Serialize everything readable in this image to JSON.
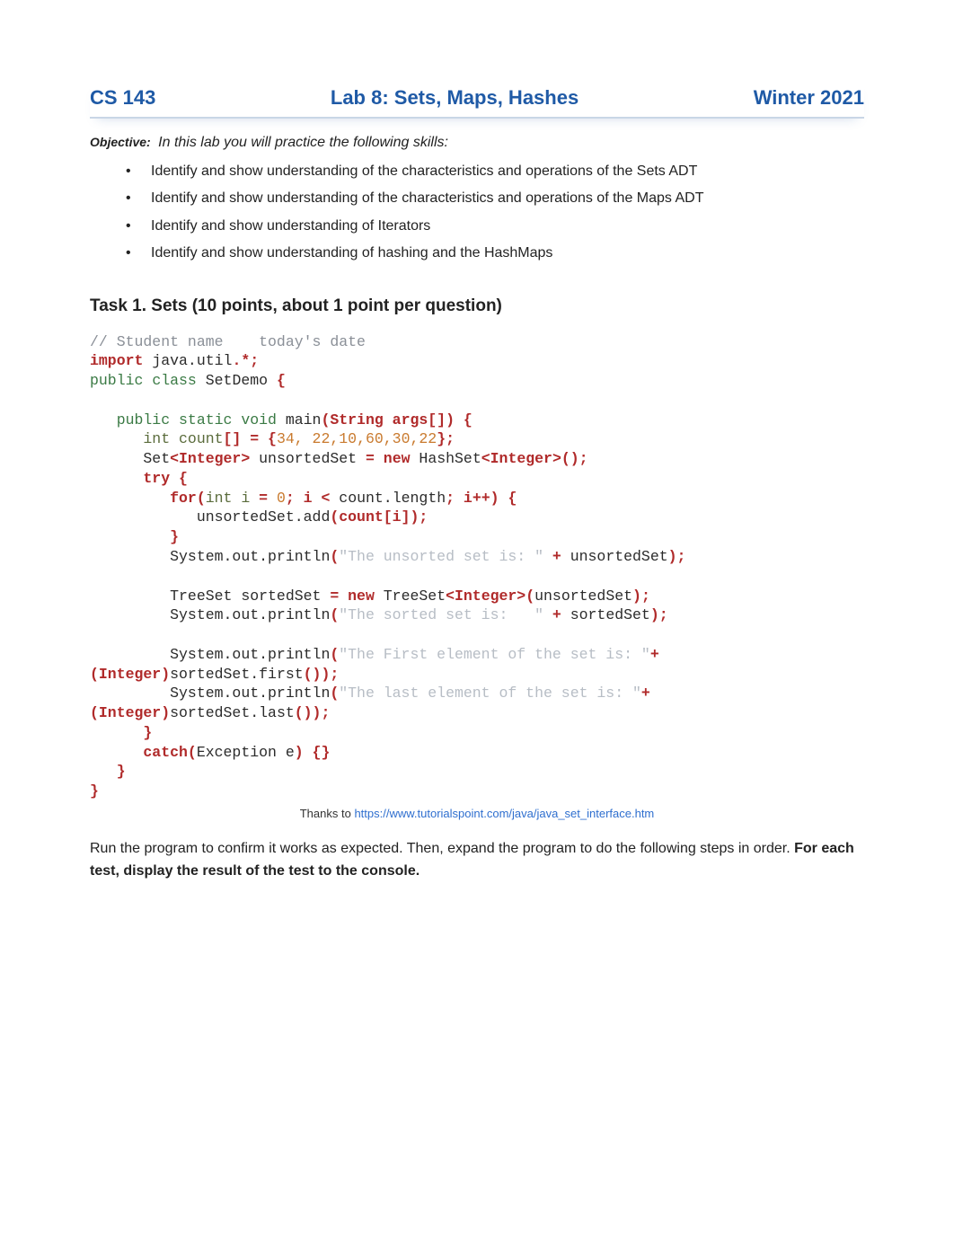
{
  "header": {
    "left": "CS 143",
    "center": "Lab 8:  Sets, Maps, Hashes",
    "right": "Winter 2021"
  },
  "objective": {
    "label": "Objective:",
    "text": "In this lab you will practice the following skills:",
    "bullets": [
      "Identify and show understanding of the characteristics and operations of the Sets ADT",
      "Identify and show understanding of the characteristics and operations of the Maps ADT",
      "Identify and show understanding of Iterators",
      "Identify and show understanding of hashing and the HashMaps"
    ]
  },
  "task": {
    "heading": "Task 1.  Sets (10 points, about 1 point per question)"
  },
  "code": {
    "comment_line": "// Student name    today's date",
    "kw_import": "import",
    "import_rest": " java.util",
    "import_star": ".*;",
    "kw_public": "public",
    "kw_class": " class",
    "class_name": " SetDemo ",
    "brace": "{",
    "main_mods": "   public static void",
    "main_name": " main",
    "main_args": "(String args[]) {",
    "count_decl1": "      int count",
    "count_decl2": "[] = {",
    "count_vals": "34, 22,10,60,30,22",
    "count_decl3": "};",
    "set_decl1": "      Set",
    "set_decl2": "<Integer>",
    "set_decl3": " unsortedSet ",
    "eq": "= ",
    "kw_new": "new",
    "hashset": " HashSet",
    "hashset2": "<Integer>();",
    "try": "      try {",
    "for1": "         for(",
    "for2": "int i ",
    "for3": "= ",
    "zero": "0",
    "for4": "; i ",
    "for5": "< ",
    "for6": "count.length",
    "for7": "; i",
    "for8": "++) {",
    "add1": "            unsortedSet.add",
    "add2": "(count[i]);",
    "close_for": "         }",
    "print1a": "         System.out.println",
    "print1b": "(",
    "str1": "\"The unsorted set is: \"",
    "plus": " + ",
    "print1c": "unsortedSet",
    "print1d": ");",
    "tree1": "         TreeSet sortedSet ",
    "tree2": "= ",
    "tree3": " TreeSet",
    "tree4": "<Integer>(",
    "tree5": "unsortedSet",
    "tree6": ");",
    "print2a": "         System.out.println",
    "print2b": "(",
    "str2": "\"The sorted set is:   \"",
    "print2c": "sortedSet",
    "print2d": ");",
    "print3a": "         System.out.println",
    "print3b": "(",
    "str3": "\"The First element of the set is: \"",
    "plus2": "+",
    "cast1": "(Integer)",
    "first1": "sortedSet.first",
    "first2": "());",
    "print4a": "         System.out.println",
    "print4b": "(",
    "str4": "\"The last element of the set is: \"",
    "cast2": "(Integer)",
    "last1": "sortedSet.last",
    "last2": "());",
    "close_try": "      }",
    "catch1": "      catch(",
    "catch2": "Exception e",
    "catch3": ") {}",
    "close_main": "   }",
    "close_class": "}"
  },
  "thanks": {
    "prefix": "Thanks to ",
    "link": "https://www.tutorialspoint.com/java/java_set_interface.htm"
  },
  "run": {
    "text1": "Run the program to confirm it works as expected. Then, expand the program to do the following steps in order. ",
    "bold": "For each test, display the result of the test to the console."
  }
}
